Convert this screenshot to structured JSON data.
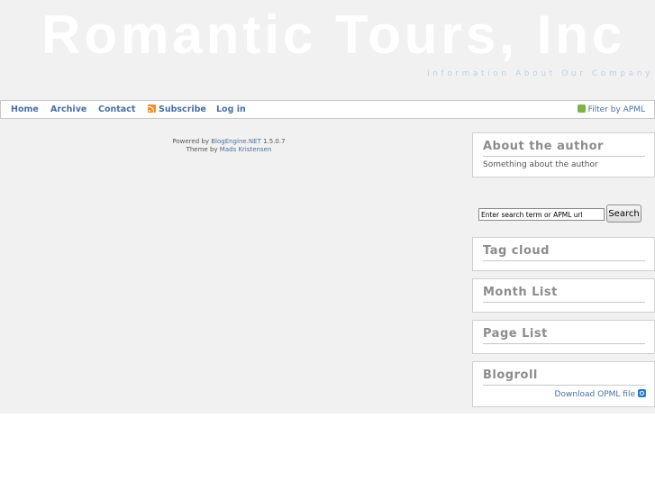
{
  "header": {
    "title": "Romantic Tours, Inc",
    "tagline": "Information About Our Company"
  },
  "nav": {
    "items": [
      {
        "label": "Home"
      },
      {
        "label": "Archive"
      },
      {
        "label": "Contact"
      },
      {
        "label": "Subscribe",
        "icon": "rss-icon"
      },
      {
        "label": "Log in"
      }
    ],
    "filter_label": "Filter by APML",
    "filter_icon": "apml-icon"
  },
  "footer": {
    "powered_prefix": "Powered by",
    "powered_link": "BlogEngine.NET",
    "version": "1.5.0.7",
    "theme_prefix": "Theme by",
    "theme_link": "Mads Kristensen"
  },
  "sidebar": {
    "author": {
      "title": "About the author",
      "text": "Something about the author"
    },
    "search": {
      "placeholder": "Enter search term or APML url",
      "button_label": "Search"
    },
    "tag_cloud": {
      "title": "Tag cloud"
    },
    "month_list": {
      "title": "Month List"
    },
    "page_list": {
      "title": "Page List"
    },
    "blogroll": {
      "title": "Blogroll",
      "opml_label": "Download OPML file",
      "opml_icon": "opml-icon"
    }
  },
  "colors": {
    "background": "#f1f1f1",
    "link": "#4a70a0",
    "widget_title": "#8c8c8c",
    "tagline": "#bcd0e0"
  }
}
